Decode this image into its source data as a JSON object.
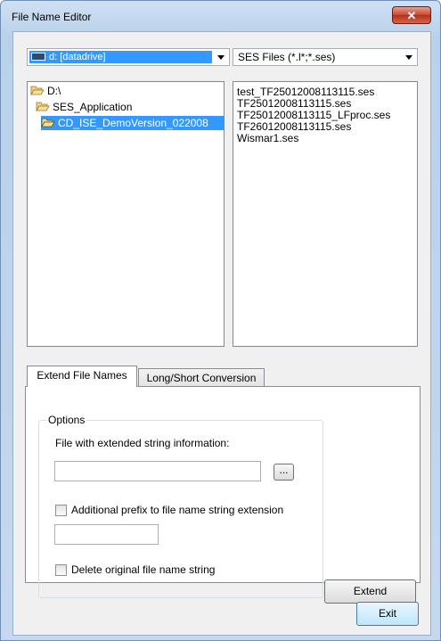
{
  "window": {
    "title": "File Name Editor",
    "close_label": "✕"
  },
  "drive_combo": {
    "value": "d: [datadrive]"
  },
  "filter_combo": {
    "value": "SES Files (*.l*;*.ses)"
  },
  "directories": [
    {
      "label": "D:\\"
    },
    {
      "label": "SES_Application"
    },
    {
      "label": "CD_ISE_DemoVersion_022008"
    }
  ],
  "files": [
    "test_TF25012008113115.ses",
    "TF25012008113115.ses",
    "TF25012008113115_LFproc.ses",
    "TF26012008113115.ses",
    "Wismar1.ses"
  ],
  "tabs": [
    {
      "label": "Extend File Names"
    },
    {
      "label": "Long/Short Conversion"
    }
  ],
  "options": {
    "group_label": "Options",
    "file_label": "File with extended string information:",
    "file_value": "",
    "browse_label": "...",
    "prefix_label": "Additional prefix to file name string extension",
    "prefix_value": "",
    "delete_label": "Delete original file name string"
  },
  "buttons": {
    "extend": "Extend",
    "exit": "Exit"
  },
  "colors": {
    "selection": "#3399ff",
    "title_bar": "#b9d1ea",
    "close": "#c9452d"
  }
}
